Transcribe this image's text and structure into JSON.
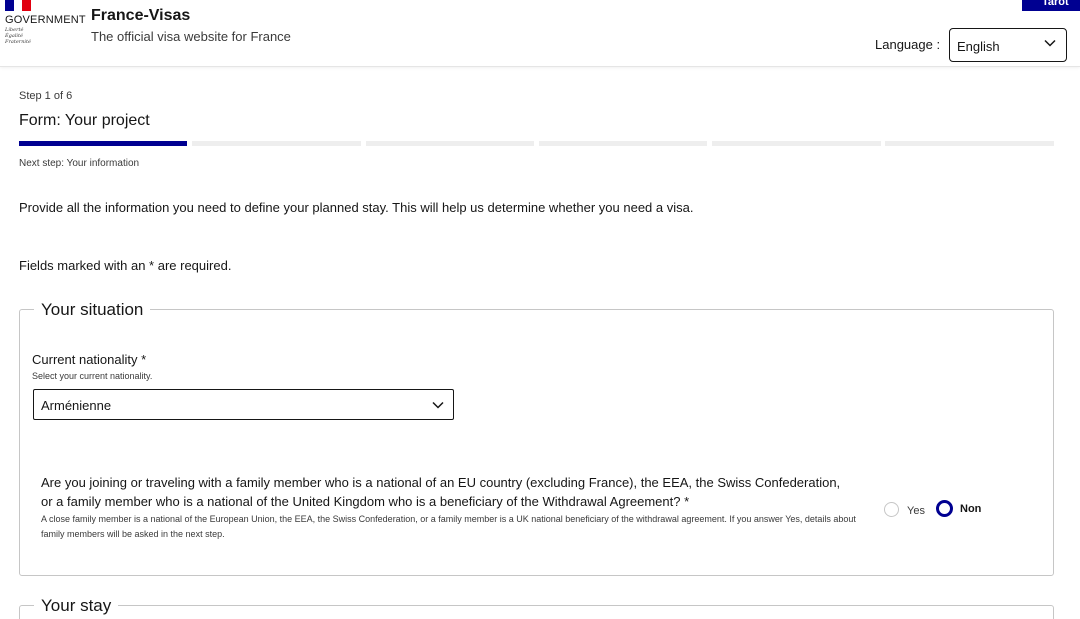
{
  "header": {
    "gov_label": "GOVERNMENT",
    "motto": [
      "Liberté",
      "Égalité",
      "Fraternité"
    ],
    "site_title": "France-Visas",
    "site_subtitle": "The official visa website for France",
    "top_tab_label": "Tarot",
    "language_label": "Language :",
    "language_value": "English",
    "brand_colors": {
      "blue": "#000091",
      "white": "#ffffff",
      "red": "#e1000f"
    }
  },
  "steps": {
    "step_count": "Step 1 of 6",
    "form_title": "Form: Your project",
    "total": 6,
    "current": 1,
    "next_step": "Next step: Your information"
  },
  "intro": "Provide all the information you need to define your planned stay. This will help us determine whether you need a visa.",
  "required_note": "Fields marked with an * are required.",
  "situation": {
    "legend": "Your situation",
    "nationality_label": "Current nationality *",
    "nationality_hint": "Select your current nationality.",
    "nationality_value": "Arménienne",
    "family_question": "Are you joining or traveling with a family member who is a national of an EU country (excluding France), the EEA, the Swiss Confederation, or a family member who is a national of the United Kingdom who is a beneficiary of the Withdrawal Agreement? *",
    "family_hint": "A close family member is a national of the European Union, the EEA, the Swiss Confederation, or a family member is a UK national beneficiary of the withdrawal agreement. If you answer Yes, details about family members will be asked in the next step.",
    "option_yes": "Yes",
    "option_no": "Non",
    "selected": "Non"
  },
  "stay": {
    "legend": "Your stay"
  },
  "icons": {
    "select_chevron": "chevron-down-icon",
    "flag": "french-flag-icon"
  }
}
